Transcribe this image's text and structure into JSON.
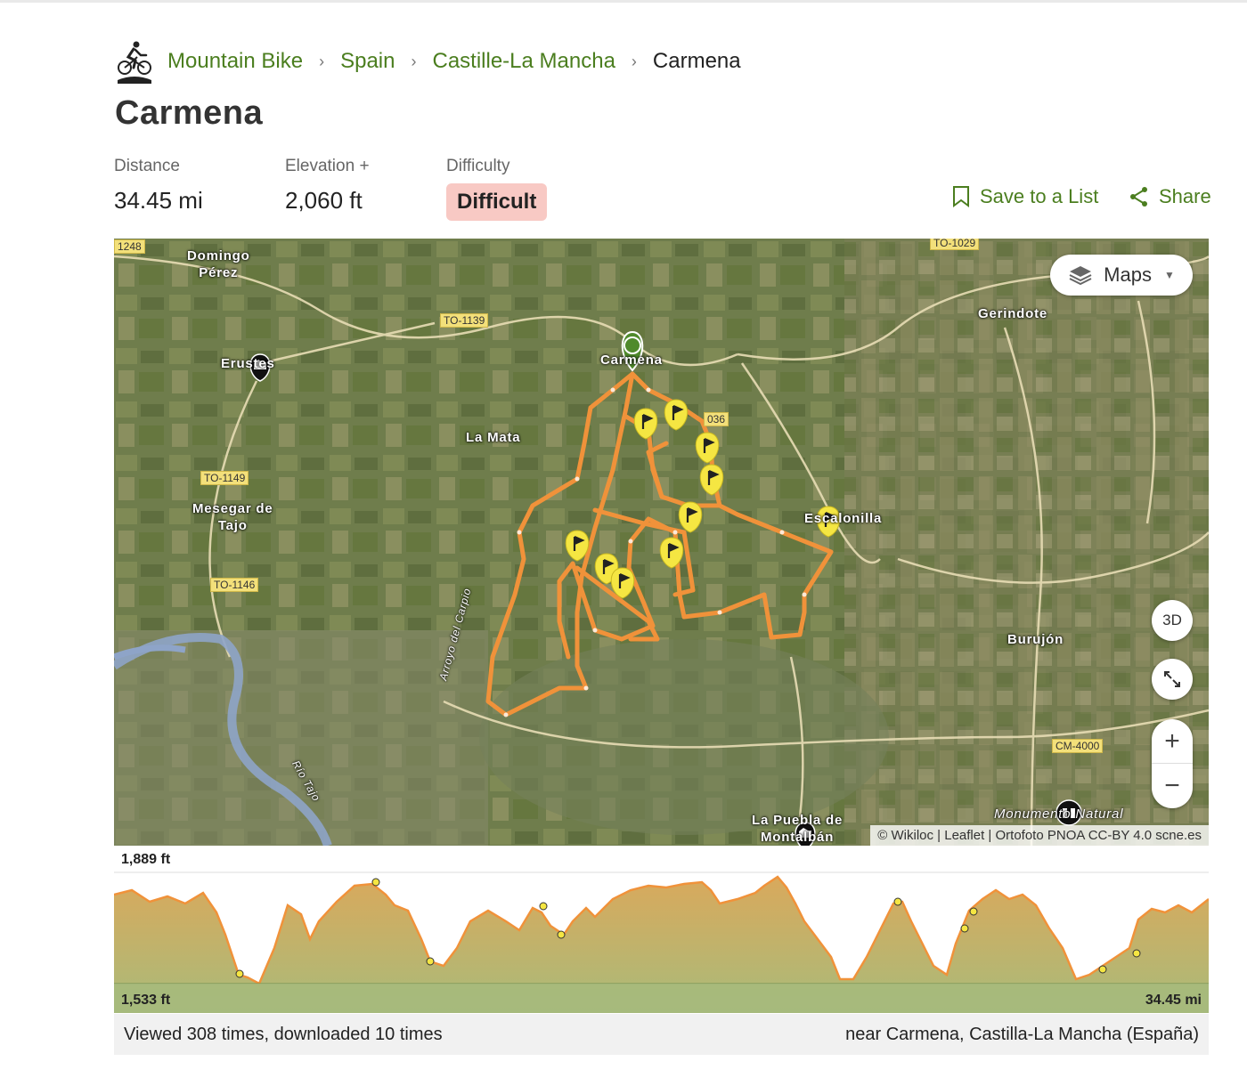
{
  "breadcrumb": {
    "items": [
      "Mountain Bike",
      "Spain",
      "Castille-La Mancha"
    ],
    "current": "Carmena"
  },
  "page": {
    "title": "Carmena"
  },
  "stats": {
    "distance_label": "Distance",
    "distance_value": "34.45 mi",
    "elevation_label": "Elevation +",
    "elevation_value": "2,060 ft",
    "difficulty_label": "Difficulty",
    "difficulty_value": "Difficult"
  },
  "actions": {
    "save": "Save to a List",
    "share": "Share"
  },
  "map": {
    "layer_button": "Maps",
    "btn_3d": "3D",
    "zoom_in": "+",
    "zoom_out": "−",
    "attribution": "© Wikiloc | Leaflet | Ortofoto PNOA CC-BY 4.0 scne.es",
    "places": {
      "domingo": "Domingo\nPérez",
      "erustes": "Erustes",
      "carmena": "Carmena",
      "lamata": "La Mata",
      "mesegar": "Mesegar de\nTajo",
      "gerindote": "Gerindote",
      "burujon": "Burujón",
      "bonilla": "Escalonilla",
      "puebla": "La Puebla de\nMontalbán",
      "monumento": "Monumento Natural"
    },
    "roads": {
      "r1248": "1248",
      "to1139": "TO-1139",
      "to1149": "TO-1149",
      "to1146": "TO-1146",
      "to1029": "TO-1029",
      "r036": "036",
      "cm4000": "CM-4000"
    },
    "rivers": {
      "tajo": "Río Tajo",
      "carpio": "Arroyo del Carpio"
    }
  },
  "elevation": {
    "max": "1,889 ft",
    "min": "1,533 ft",
    "total_distance": "34.45 mi"
  },
  "footer": {
    "views": "Viewed 308 times, downloaded 10 times",
    "near": "near Carmena, Castilla-La Mancha (España)"
  },
  "colors": {
    "brand_green": "#4b7e1f",
    "route_orange": "#f0923a",
    "difficulty_bg": "#f8c9c4",
    "waypoint_yellow": "#f5e642"
  },
  "icons": [
    "cyclist-icon",
    "bookmark-icon",
    "share-icon",
    "layers-icon",
    "expand-icon",
    "start-pin-icon",
    "flag-icon",
    "town-icon",
    "binoculars-icon"
  ]
}
